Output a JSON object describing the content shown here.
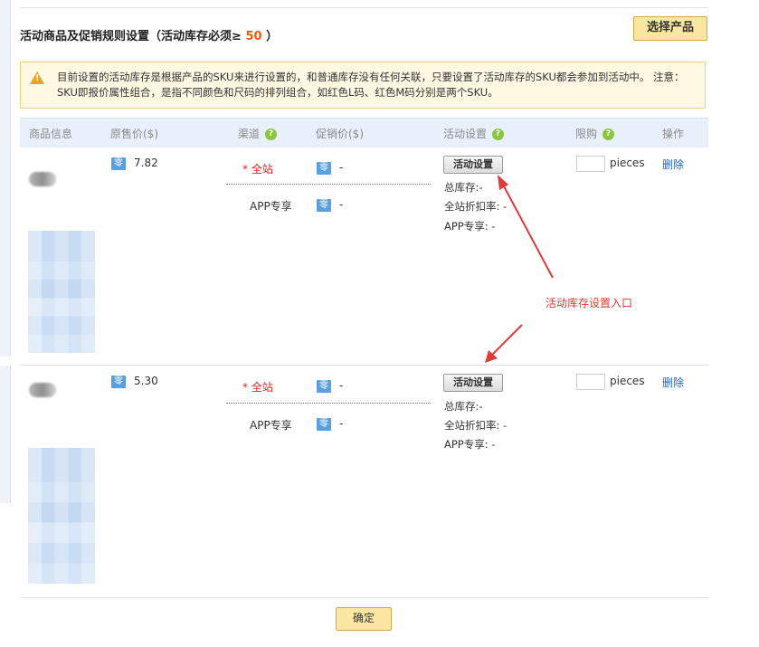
{
  "header": {
    "title_prefix": "活动商品及促销规则设置（",
    "title_req_label": "活动库存必须≥",
    "title_req_value": "50",
    "title_suffix": "）",
    "choose_button": "选择产品"
  },
  "notice": {
    "text": "目前设置的活动库存是根据产品的SKU来进行设置的，和普通库存没有任何关联，只要设置了活动库存的SKU都会参加到活动中。 注意：SKU即报价属性组合，是指不同颜色和尺码的排列组合，如红色L码、红色M码分别是两个SKU。"
  },
  "table": {
    "headers": {
      "product": "商品信息",
      "price": "原售价($)",
      "channel": "渠道",
      "promo": "促销价($)",
      "activity": "活动设置",
      "limit": "限购",
      "action": "操作"
    },
    "help_glyph": "?",
    "rows": [
      {
        "price_icon": "零",
        "price": "7.82",
        "channel_main": "* 全站",
        "channel_app": "APP专享",
        "promo_icon": "零",
        "promo_main": "-",
        "promo_app": "-",
        "activity_button": "活动设置",
        "total_stock": "总库存:-",
        "site_discount": "全站折扣率: -",
        "app_exclusive": "APP专享: -",
        "limit_unit": "pieces",
        "delete_label": "删除"
      },
      {
        "price_icon": "零",
        "price": "5.30",
        "channel_main": "* 全站",
        "channel_app": "APP专享",
        "promo_icon": "零",
        "promo_main": "-",
        "promo_app": "-",
        "activity_button": "活动设置",
        "total_stock": "总库存:-",
        "site_discount": "全站折扣率: -",
        "app_exclusive": "APP专享: -",
        "limit_unit": "pieces",
        "delete_label": "删除"
      }
    ]
  },
  "annotation": "活动库存设置入口",
  "footer": {
    "confirm_button": "确定"
  },
  "icons": {
    "warning": "warning-triangle-icon",
    "help": "help-circle-icon",
    "currency": "price-tag-icon"
  },
  "colors": {
    "accent_orange": "#e06010",
    "button_yellow": "#fbe7a1",
    "header_blue": "#e8f0fb",
    "link_blue": "#1a66c6",
    "annotation_red": "#e03a3a",
    "help_green": "#8cc63f"
  }
}
